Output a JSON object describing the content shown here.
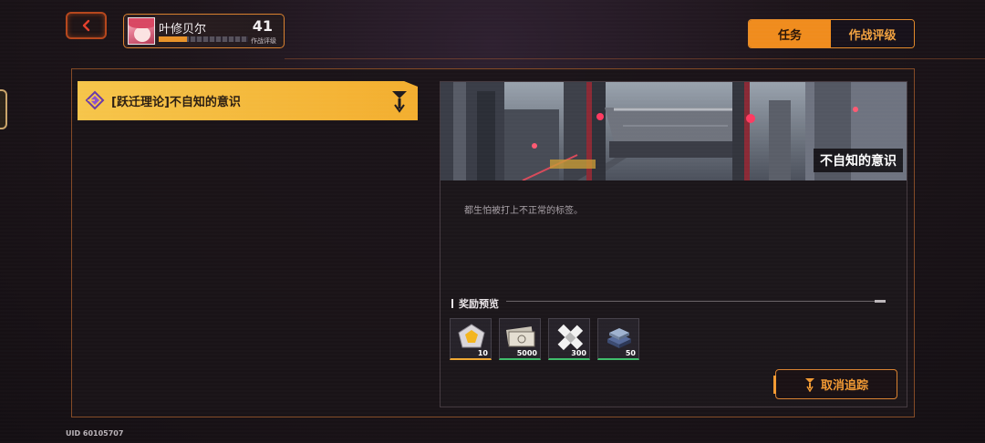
{
  "header": {
    "back_icon": "chevron-left-icon",
    "player": {
      "name": "叶修贝尔",
      "level": "41",
      "level_caption": "作战评级",
      "level_progress": 0.32
    },
    "tabs": [
      {
        "label": "任务",
        "active": true
      },
      {
        "label": "作战评级",
        "active": false
      }
    ]
  },
  "quest_list": [
    {
      "label": "[跃迁理论]不自知的意识",
      "selected": true,
      "icon": "diamond-quest-icon",
      "track_icon": "track-marker-icon"
    }
  ],
  "detail": {
    "banner_title": "不自知的意识",
    "description": "都生怕被打上不正常的标签。",
    "rewards_heading": "奖励预览",
    "rewards": [
      {
        "name": "gem-crystal-icon",
        "count": "10",
        "rarity": "gold"
      },
      {
        "name": "banknote-icon",
        "count": "5000",
        "rarity": "green"
      },
      {
        "name": "crossed-bandage-icon",
        "count": "300",
        "rarity": "green"
      },
      {
        "name": "chip-stack-icon",
        "count": "50",
        "rarity": "green"
      }
    ],
    "untrack_label": "取消追踪"
  },
  "footer": {
    "uid": "UID 60105707"
  },
  "colors": {
    "accent": "#f08c1d",
    "quest_yellow": "#f6c54a",
    "frame_orange": "#d9812f"
  }
}
